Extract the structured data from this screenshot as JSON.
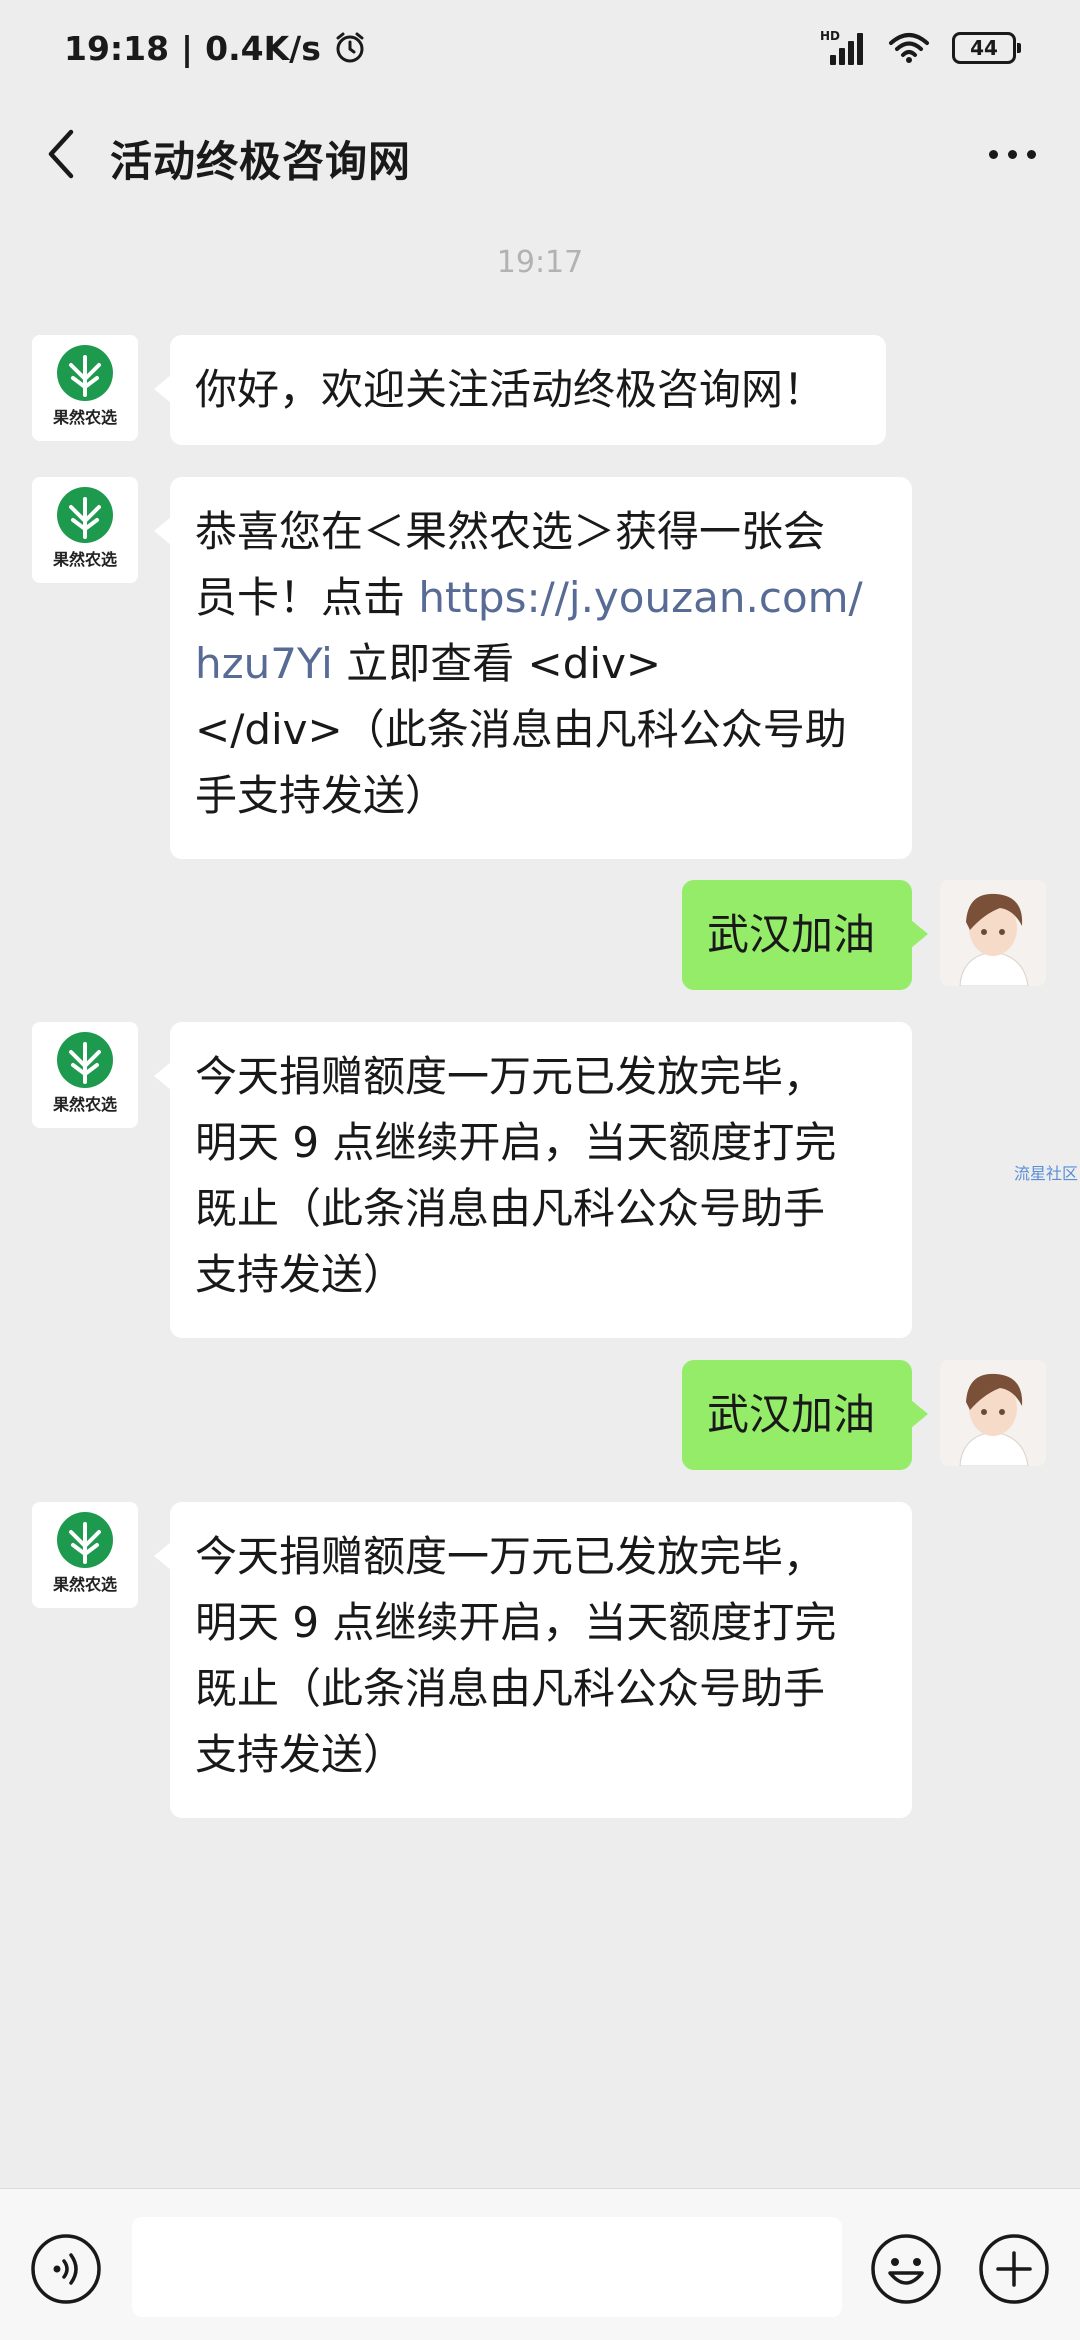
{
  "status_bar": {
    "time": "19:18",
    "speed": "0.4K/s",
    "network_label": "HD",
    "battery": "44"
  },
  "nav": {
    "title": "活动终极咨询网"
  },
  "chat": {
    "time_label": "19:17",
    "messages": [
      {
        "sender": "official",
        "text": "你好，欢迎关注活动终极咨询网！"
      },
      {
        "sender": "official",
        "line1": "恭喜您在＜果然农选＞获得一张会",
        "line2_prefix": "员卡！点击 ",
        "link_part1": "https://j.youzan.com/",
        "link_part2": "hzu7Yi",
        "line3_suffix": " 立即查看 <div>",
        "line4": "</div>（此条消息由凡科公众号助",
        "line5": "手支持发送）"
      },
      {
        "sender": "me",
        "text": "武汉加油"
      },
      {
        "sender": "official",
        "line1": "今天捐赠额度一万元已发放完毕，",
        "line2": "明天 9 点继续开启，当天额度打完",
        "line3": "既止（此条消息由凡科公众号助手",
        "line4": "支持发送）"
      },
      {
        "sender": "me",
        "text": "武汉加油"
      },
      {
        "sender": "official",
        "line1": "今天捐赠额度一万元已发放完毕，",
        "line2": "明天 9 点继续开启，当天额度打完",
        "line3": "既止（此条消息由凡科公众号助手",
        "line4": "支持发送）"
      }
    ],
    "official_avatar_text": "果然农选",
    "watermark": "流星社区"
  },
  "input_bar": {
    "placeholder": ""
  },
  "colors": {
    "background": "#ededed",
    "self_bubble": "#95ec69",
    "other_bubble": "#ffffff",
    "link": "#576b95",
    "logo_green": "#1e9a4f"
  },
  "icons": [
    "back-arrow-icon",
    "more-dots-icon",
    "voice-icon",
    "emoji-icon",
    "plus-icon",
    "alarm-icon",
    "wifi-icon",
    "signal-icon",
    "battery-icon"
  ]
}
